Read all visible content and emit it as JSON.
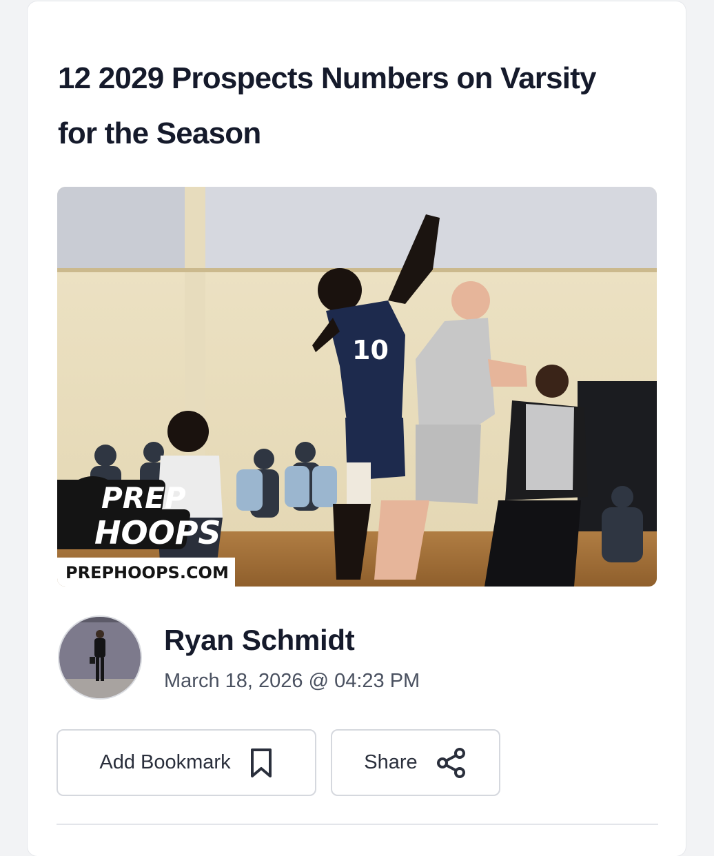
{
  "article": {
    "title": "12 2029 Prospects Numbers on Varsity for the Season"
  },
  "hero": {
    "logo_line1": "PREP",
    "logo_line2": "HOOPS",
    "watermark": "PREPHOOPS.COM",
    "jersey_number": "10"
  },
  "author": {
    "name": "Ryan Schmidt",
    "date": "March 18, 2026 @ 04:23 PM"
  },
  "actions": {
    "bookmark_label": "Add Bookmark",
    "share_label": "Share"
  },
  "colors": {
    "title": "#151a2b",
    "brand_orange": "#ec6a1c",
    "border": "#d5d8de"
  }
}
